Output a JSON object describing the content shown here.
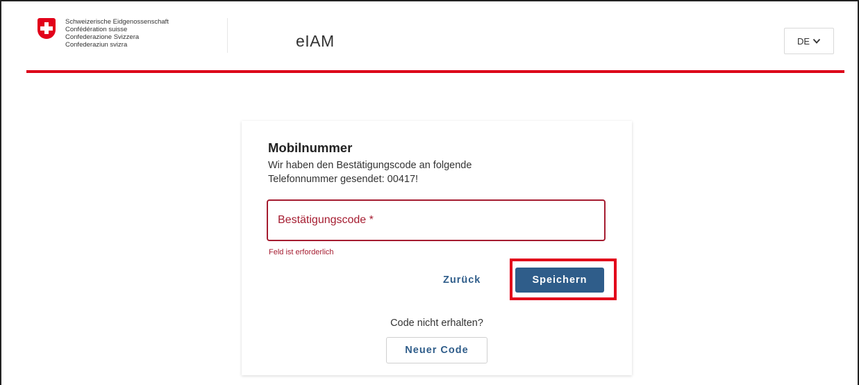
{
  "header": {
    "confederation_lines": [
      "Schweizerische Eidgenossenschaft",
      "Confédération suisse",
      "Confederazione Svizzera",
      "Confederaziun svizra"
    ],
    "app_title": "eIAM",
    "language": "DE",
    "logo_icon": "swiss-cross-icon",
    "accent_color": "#dc0018"
  },
  "card": {
    "title": "Mobilnummer",
    "description_line1": "Wir haben den Bestätigungscode an folgende",
    "description_line2": "Telefonnummer gesendet: 00417!",
    "code_field": {
      "placeholder": "Bestätigungscode *",
      "value": ""
    },
    "error_text": "Feld ist erforderlich",
    "back_label": "Zurück",
    "save_label": "Speichern",
    "code_not_received": "Code nicht erhalten?",
    "new_code_label": "Neuer Code",
    "error_color": "#a51c30",
    "primary_color": "#2f5d8a"
  }
}
